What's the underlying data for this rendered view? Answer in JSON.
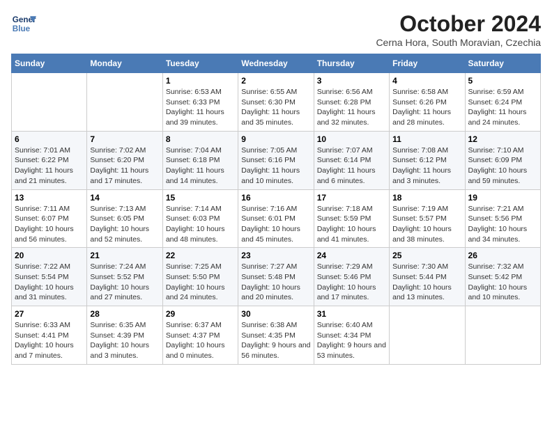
{
  "logo": {
    "line1": "General",
    "line2": "Blue"
  },
  "title": "October 2024",
  "subtitle": "Cerna Hora, South Moravian, Czechia",
  "days_of_week": [
    "Sunday",
    "Monday",
    "Tuesday",
    "Wednesday",
    "Thursday",
    "Friday",
    "Saturday"
  ],
  "weeks": [
    [
      null,
      null,
      {
        "day": "1",
        "sunrise": "Sunrise: 6:53 AM",
        "sunset": "Sunset: 6:33 PM",
        "daylight": "Daylight: 11 hours and 39 minutes."
      },
      {
        "day": "2",
        "sunrise": "Sunrise: 6:55 AM",
        "sunset": "Sunset: 6:30 PM",
        "daylight": "Daylight: 11 hours and 35 minutes."
      },
      {
        "day": "3",
        "sunrise": "Sunrise: 6:56 AM",
        "sunset": "Sunset: 6:28 PM",
        "daylight": "Daylight: 11 hours and 32 minutes."
      },
      {
        "day": "4",
        "sunrise": "Sunrise: 6:58 AM",
        "sunset": "Sunset: 6:26 PM",
        "daylight": "Daylight: 11 hours and 28 minutes."
      },
      {
        "day": "5",
        "sunrise": "Sunrise: 6:59 AM",
        "sunset": "Sunset: 6:24 PM",
        "daylight": "Daylight: 11 hours and 24 minutes."
      }
    ],
    [
      {
        "day": "6",
        "sunrise": "Sunrise: 7:01 AM",
        "sunset": "Sunset: 6:22 PM",
        "daylight": "Daylight: 11 hours and 21 minutes."
      },
      {
        "day": "7",
        "sunrise": "Sunrise: 7:02 AM",
        "sunset": "Sunset: 6:20 PM",
        "daylight": "Daylight: 11 hours and 17 minutes."
      },
      {
        "day": "8",
        "sunrise": "Sunrise: 7:04 AM",
        "sunset": "Sunset: 6:18 PM",
        "daylight": "Daylight: 11 hours and 14 minutes."
      },
      {
        "day": "9",
        "sunrise": "Sunrise: 7:05 AM",
        "sunset": "Sunset: 6:16 PM",
        "daylight": "Daylight: 11 hours and 10 minutes."
      },
      {
        "day": "10",
        "sunrise": "Sunrise: 7:07 AM",
        "sunset": "Sunset: 6:14 PM",
        "daylight": "Daylight: 11 hours and 6 minutes."
      },
      {
        "day": "11",
        "sunrise": "Sunrise: 7:08 AM",
        "sunset": "Sunset: 6:12 PM",
        "daylight": "Daylight: 11 hours and 3 minutes."
      },
      {
        "day": "12",
        "sunrise": "Sunrise: 7:10 AM",
        "sunset": "Sunset: 6:09 PM",
        "daylight": "Daylight: 10 hours and 59 minutes."
      }
    ],
    [
      {
        "day": "13",
        "sunrise": "Sunrise: 7:11 AM",
        "sunset": "Sunset: 6:07 PM",
        "daylight": "Daylight: 10 hours and 56 minutes."
      },
      {
        "day": "14",
        "sunrise": "Sunrise: 7:13 AM",
        "sunset": "Sunset: 6:05 PM",
        "daylight": "Daylight: 10 hours and 52 minutes."
      },
      {
        "day": "15",
        "sunrise": "Sunrise: 7:14 AM",
        "sunset": "Sunset: 6:03 PM",
        "daylight": "Daylight: 10 hours and 48 minutes."
      },
      {
        "day": "16",
        "sunrise": "Sunrise: 7:16 AM",
        "sunset": "Sunset: 6:01 PM",
        "daylight": "Daylight: 10 hours and 45 minutes."
      },
      {
        "day": "17",
        "sunrise": "Sunrise: 7:18 AM",
        "sunset": "Sunset: 5:59 PM",
        "daylight": "Daylight: 10 hours and 41 minutes."
      },
      {
        "day": "18",
        "sunrise": "Sunrise: 7:19 AM",
        "sunset": "Sunset: 5:57 PM",
        "daylight": "Daylight: 10 hours and 38 minutes."
      },
      {
        "day": "19",
        "sunrise": "Sunrise: 7:21 AM",
        "sunset": "Sunset: 5:56 PM",
        "daylight": "Daylight: 10 hours and 34 minutes."
      }
    ],
    [
      {
        "day": "20",
        "sunrise": "Sunrise: 7:22 AM",
        "sunset": "Sunset: 5:54 PM",
        "daylight": "Daylight: 10 hours and 31 minutes."
      },
      {
        "day": "21",
        "sunrise": "Sunrise: 7:24 AM",
        "sunset": "Sunset: 5:52 PM",
        "daylight": "Daylight: 10 hours and 27 minutes."
      },
      {
        "day": "22",
        "sunrise": "Sunrise: 7:25 AM",
        "sunset": "Sunset: 5:50 PM",
        "daylight": "Daylight: 10 hours and 24 minutes."
      },
      {
        "day": "23",
        "sunrise": "Sunrise: 7:27 AM",
        "sunset": "Sunset: 5:48 PM",
        "daylight": "Daylight: 10 hours and 20 minutes."
      },
      {
        "day": "24",
        "sunrise": "Sunrise: 7:29 AM",
        "sunset": "Sunset: 5:46 PM",
        "daylight": "Daylight: 10 hours and 17 minutes."
      },
      {
        "day": "25",
        "sunrise": "Sunrise: 7:30 AM",
        "sunset": "Sunset: 5:44 PM",
        "daylight": "Daylight: 10 hours and 13 minutes."
      },
      {
        "day": "26",
        "sunrise": "Sunrise: 7:32 AM",
        "sunset": "Sunset: 5:42 PM",
        "daylight": "Daylight: 10 hours and 10 minutes."
      }
    ],
    [
      {
        "day": "27",
        "sunrise": "Sunrise: 6:33 AM",
        "sunset": "Sunset: 4:41 PM",
        "daylight": "Daylight: 10 hours and 7 minutes."
      },
      {
        "day": "28",
        "sunrise": "Sunrise: 6:35 AM",
        "sunset": "Sunset: 4:39 PM",
        "daylight": "Daylight: 10 hours and 3 minutes."
      },
      {
        "day": "29",
        "sunrise": "Sunrise: 6:37 AM",
        "sunset": "Sunset: 4:37 PM",
        "daylight": "Daylight: 10 hours and 0 minutes."
      },
      {
        "day": "30",
        "sunrise": "Sunrise: 6:38 AM",
        "sunset": "Sunset: 4:35 PM",
        "daylight": "Daylight: 9 hours and 56 minutes."
      },
      {
        "day": "31",
        "sunrise": "Sunrise: 6:40 AM",
        "sunset": "Sunset: 4:34 PM",
        "daylight": "Daylight: 9 hours and 53 minutes."
      },
      null,
      null
    ]
  ]
}
